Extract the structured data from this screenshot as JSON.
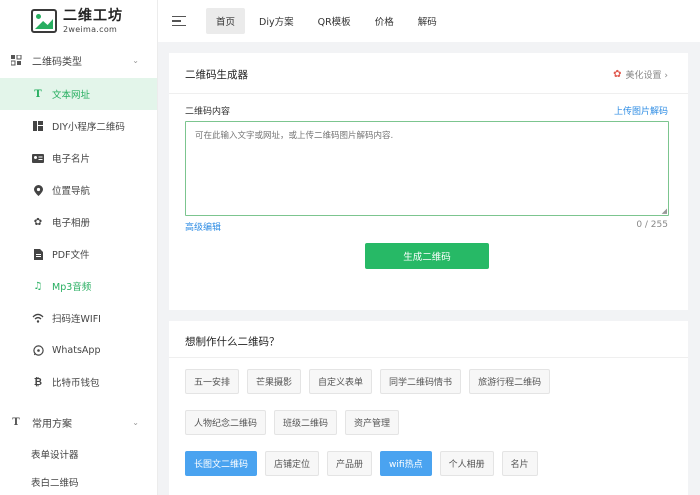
{
  "logo": {
    "name": "二维工坊",
    "domain": "2weima.com"
  },
  "sidebar": {
    "group1": {
      "label": "二维码类型",
      "icon": "grid-icon"
    },
    "items": [
      {
        "label": "文本网址",
        "icon": "text-icon",
        "state": "active"
      },
      {
        "label": "DIY小程序二维码",
        "icon": "diy-icon"
      },
      {
        "label": "电子名片",
        "icon": "card-icon"
      },
      {
        "label": "位置导航",
        "icon": "location-icon"
      },
      {
        "label": "电子相册",
        "icon": "album-icon"
      },
      {
        "label": "PDF文件",
        "icon": "pdf-icon"
      },
      {
        "label": "Mp3音频",
        "icon": "music-icon",
        "state": "green"
      },
      {
        "label": "扫码连WIFI",
        "icon": "wifi-icon"
      },
      {
        "label": "WhatsApp",
        "icon": "whatsapp-icon"
      },
      {
        "label": "比特币钱包",
        "icon": "bitcoin-icon"
      }
    ],
    "group2": {
      "label": "常用方案",
      "icon": "solution-icon"
    },
    "sub_items": [
      {
        "label": "表单设计器"
      },
      {
        "label": "表白二维码"
      }
    ]
  },
  "topnav": {
    "items": [
      {
        "label": "首页",
        "active": true
      },
      {
        "label": "Diy方案"
      },
      {
        "label": "QR模板"
      },
      {
        "label": "价格"
      },
      {
        "label": "解码"
      }
    ]
  },
  "generator": {
    "title": "二维码生成器",
    "beautify_label": "美化设置 ›",
    "field_label": "二维码内容",
    "upload_link": "上传图片解码",
    "placeholder": "可在此输入文字或网址，或上传二维码图片解码内容.",
    "advanced_link": "高级编辑",
    "counter": "0 / 255",
    "generate_button": "生成二维码"
  },
  "ideas": {
    "title": "想制作什么二维码？",
    "row1": [
      "五一安排",
      "芒果摄影",
      "自定义表单",
      "同学二维码情书",
      "旅游行程二维码"
    ],
    "row2": [
      "人物纪念二维码",
      "班级二维码",
      "资产管理"
    ],
    "row3": [
      {
        "label": "长图文二维码",
        "highlight": true
      },
      {
        "label": "店铺定位"
      },
      {
        "label": "产品册"
      },
      {
        "label": "wifi热点",
        "highlight": true
      },
      {
        "label": "个人相册"
      },
      {
        "label": "名片"
      }
    ]
  },
  "colors": {
    "brand_green": "#27b966",
    "link_blue": "#2f8de4",
    "tag_blue": "#4aa3f0",
    "accent_red": "#e05a4f"
  }
}
